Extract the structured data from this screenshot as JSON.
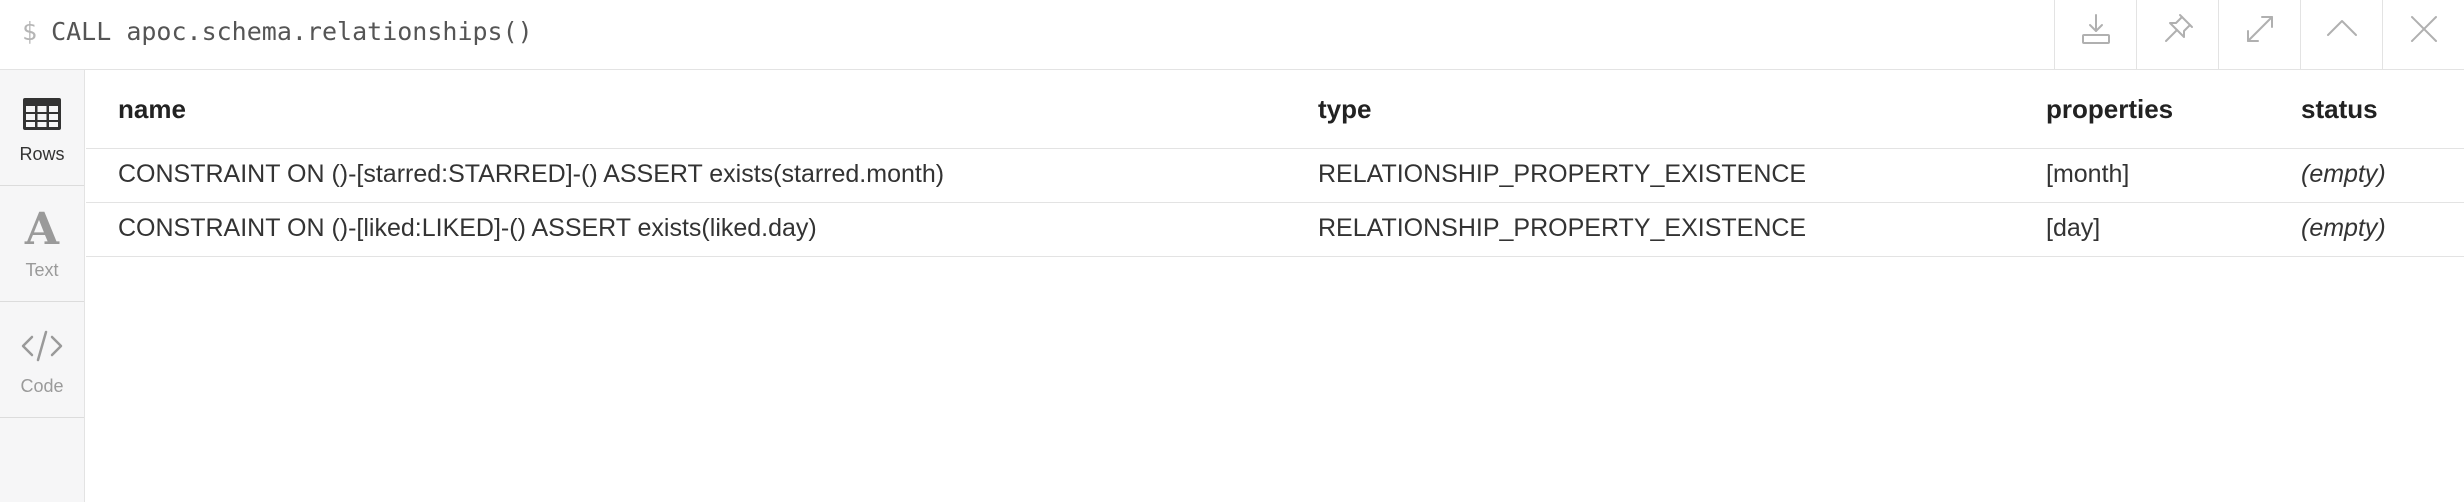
{
  "query": {
    "prompt": "$",
    "text": "CALL apoc.schema.relationships()"
  },
  "actions": [
    {
      "name": "download-icon"
    },
    {
      "name": "pin-icon"
    },
    {
      "name": "expand-icon"
    },
    {
      "name": "collapse-up-icon"
    },
    {
      "name": "close-icon"
    }
  ],
  "sidebar": {
    "items": [
      {
        "label": "Rows",
        "icon": "table-icon",
        "active": true
      },
      {
        "label": "Text",
        "icon": "text-icon",
        "active": false
      },
      {
        "label": "Code",
        "icon": "code-icon",
        "active": false
      }
    ]
  },
  "table": {
    "headers": [
      "name",
      "type",
      "properties",
      "status"
    ],
    "rows": [
      [
        "CONSTRAINT ON ()-[starred:STARRED]-() ASSERT exists(starred.month)",
        "RELATIONSHIP_PROPERTY_EXISTENCE",
        "[month]",
        "(empty)"
      ],
      [
        "CONSTRAINT ON ()-[liked:LIKED]-() ASSERT exists(liked.day)",
        "RELATIONSHIP_PROPERTY_EXISTENCE",
        "[day]",
        "(empty)"
      ]
    ]
  },
  "colors": {
    "border": "#e3e3e3",
    "sidebar_bg": "#f6f6f7",
    "icon_gray": "#b0b0b0",
    "text": "#333333"
  }
}
